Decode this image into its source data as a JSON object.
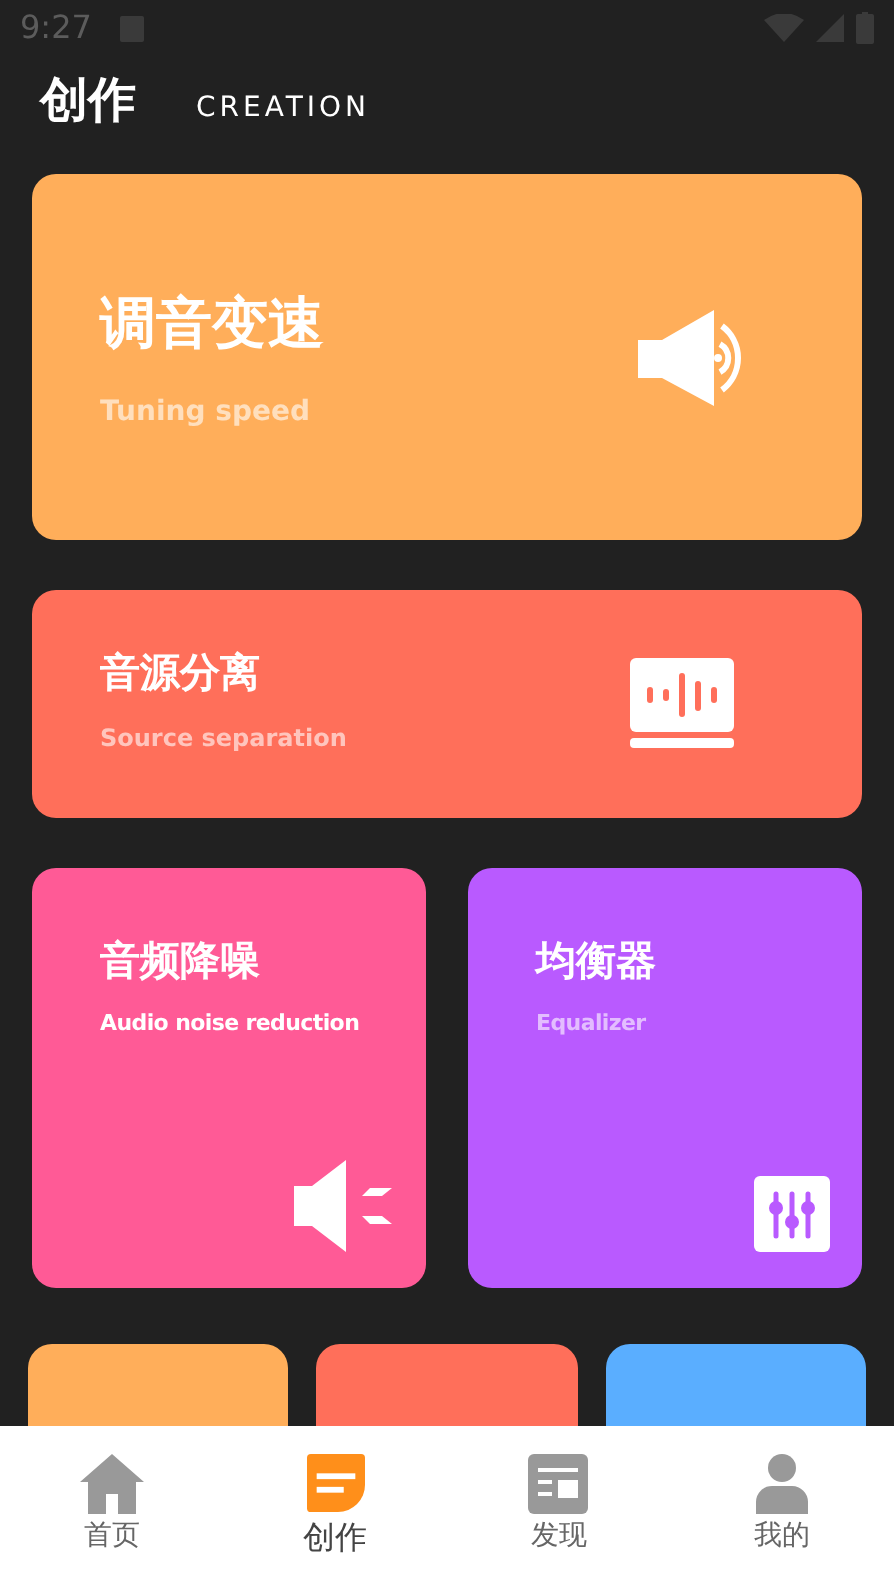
{
  "status_bar": {
    "time": "9:27"
  },
  "header": {
    "title": "创作",
    "subtitle": "CREATION"
  },
  "cards": [
    {
      "title": "调音变速",
      "subtitle": "Tuning speed",
      "color": "#ffae5a",
      "kind": "speaker"
    },
    {
      "title": "音源分离",
      "subtitle": "Source separation",
      "color": "#ff6f5a",
      "kind": "wave"
    },
    {
      "title": "音频降噪",
      "subtitle": "Audio noise reduction",
      "color": "#ff5a96",
      "kind": "noise"
    },
    {
      "title": "均衡器",
      "subtitle": "Equalizer",
      "color": "#b95aff",
      "kind": "equalizer"
    }
  ],
  "more_cards": [
    {
      "color": "#ffae5a"
    },
    {
      "color": "#ff6f5a"
    },
    {
      "color": "#5aaeff"
    }
  ],
  "tabs": [
    {
      "label": "首页",
      "kind": "home",
      "selected": false
    },
    {
      "label": "创作",
      "kind": "create",
      "selected": true
    },
    {
      "label": "发现",
      "kind": "discover",
      "selected": false
    },
    {
      "label": "我的",
      "kind": "profile",
      "selected": false
    }
  ]
}
